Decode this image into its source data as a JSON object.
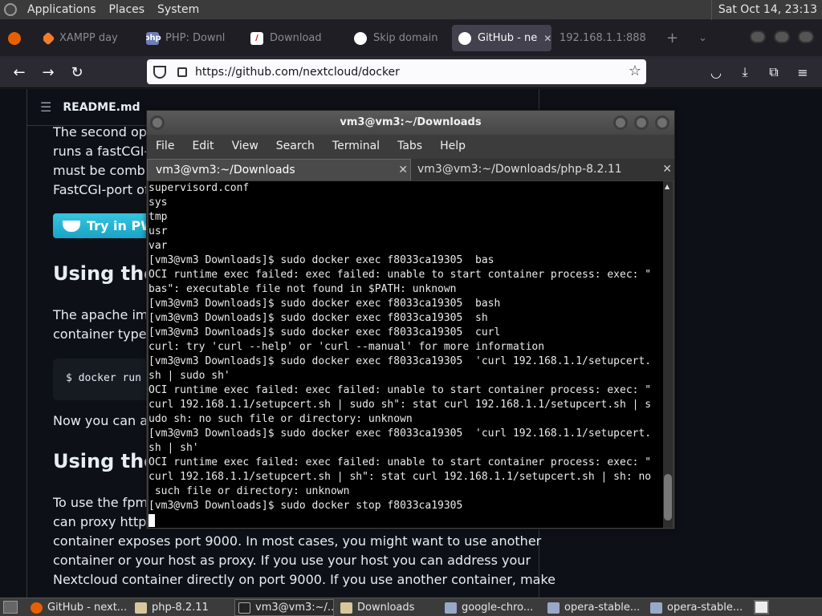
{
  "panel": {
    "menus": [
      "Applications",
      "Places",
      "System"
    ],
    "clock": "Sat Oct 14, 23:13"
  },
  "browser": {
    "tabs": [
      {
        "label": "XAMPP day"
      },
      {
        "label": "PHP: Downl"
      },
      {
        "label": "Download"
      },
      {
        "label": "Skip domain"
      },
      {
        "label": "GitHub - ne",
        "active": true
      },
      {
        "label": "192.168.1.1:888"
      }
    ],
    "url": "https://github.com/nextcloud/docker"
  },
  "readme": {
    "header": "README.md",
    "lines_top": [
      "The second optio",
      "runs a fastCGI-P",
      "must be combine",
      "FastCGI-port of t"
    ],
    "pwd_button": "Try in PWD",
    "heading1": "Using the",
    "para2": [
      "The apache imag",
      "container type:"
    ],
    "code": "$ docker run",
    "para3": "Now you can acc",
    "heading2": "Using the",
    "para4": [
      "To use the fpm im",
      "can proxy http-re",
      "container exposes port 9000. In most cases, you might want to use another",
      "container or your host as proxy. If you use your host you can address your",
      "Nextcloud container directly on port 9000. If you use another container, make"
    ]
  },
  "terminal": {
    "title": "vm3@vm3:~/Downloads",
    "menu": [
      "File",
      "Edit",
      "View",
      "Search",
      "Terminal",
      "Tabs",
      "Help"
    ],
    "tabs": [
      "vm3@vm3:~/Downloads",
      "vm3@vm3:~/Downloads/php-8.2.11"
    ],
    "lines": [
      "supervisord.conf",
      "sys",
      "tmp",
      "usr",
      "var",
      "[vm3@vm3 Downloads]$ sudo docker exec f8033ca19305  bas",
      "OCI runtime exec failed: exec failed: unable to start container process: exec: \"",
      "bas\": executable file not found in $PATH: unknown",
      "[vm3@vm3 Downloads]$ sudo docker exec f8033ca19305  bash",
      "[vm3@vm3 Downloads]$ sudo docker exec f8033ca19305  sh",
      "[vm3@vm3 Downloads]$ sudo docker exec f8033ca19305  curl",
      "curl: try 'curl --help' or 'curl --manual' for more information",
      "[vm3@vm3 Downloads]$ sudo docker exec f8033ca19305  'curl 192.168.1.1/setupcert.",
      "sh | sudo sh'",
      "OCI runtime exec failed: exec failed: unable to start container process: exec: \"",
      "curl 192.168.1.1/setupcert.sh | sudo sh\": stat curl 192.168.1.1/setupcert.sh | s",
      "udo sh: no such file or directory: unknown",
      "[vm3@vm3 Downloads]$ sudo docker exec f8033ca19305  'curl 192.168.1.1/setupcert.",
      "sh | sh'",
      "OCI runtime exec failed: exec failed: unable to start container process: exec: \"",
      "curl 192.168.1.1/setupcert.sh | sh\": stat curl 192.168.1.1/setupcert.sh | sh: no",
      " such file or directory: unknown",
      "[vm3@vm3 Downloads]$ sudo docker stop f8033ca19305"
    ]
  },
  "taskbar": {
    "items": [
      {
        "label": "GitHub - next..."
      },
      {
        "label": "php-8.2.11"
      },
      {
        "label": "vm3@vm3:~/..."
      },
      {
        "label": "Downloads"
      },
      {
        "label": "google-chro..."
      },
      {
        "label": "opera-stable..."
      },
      {
        "label": "opera-stable..."
      }
    ]
  }
}
